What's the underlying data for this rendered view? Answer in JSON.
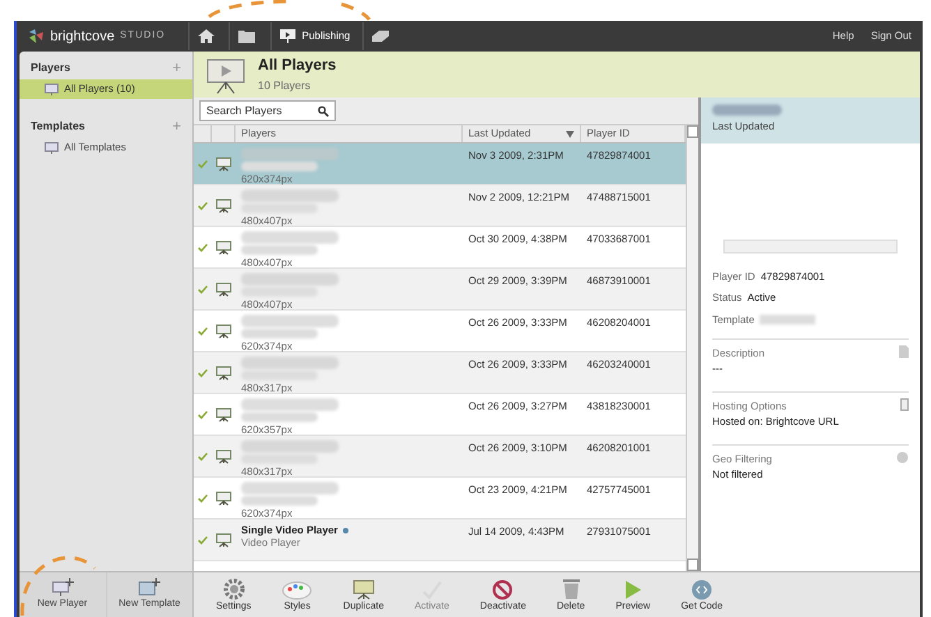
{
  "top_bar": {
    "logo": "brightcove",
    "logo_suffix": "STUDIO",
    "nav": [
      {
        "kind": "home"
      },
      {
        "kind": "folder"
      },
      {
        "kind": "publishing",
        "label": "Publishing"
      },
      {
        "kind": "stack"
      }
    ],
    "links": [
      "Help",
      "Sign Out"
    ]
  },
  "sidebar": {
    "sections": [
      {
        "title": "Players",
        "action": "+",
        "items": [
          {
            "label": "All Players",
            "count": "(10)",
            "selected": true
          }
        ]
      },
      {
        "title": "Templates",
        "action": "+",
        "items": [
          {
            "label": "All Templates",
            "selected": false
          }
        ]
      }
    ]
  },
  "header": {
    "title": "All Players",
    "subtitle": "10 Players"
  },
  "search": {
    "placeholder": "Search Players"
  },
  "table": {
    "columns": [
      "Players",
      "Last Updated",
      "Player ID"
    ],
    "rows": [
      {
        "size": "620x374px",
        "updated": "Nov 3 2009, 2:31PM",
        "id": "47829874001",
        "selected": true,
        "active": true
      },
      {
        "size": "480x407px",
        "updated": "Nov 2 2009, 12:21PM",
        "id": "47488715001",
        "selected": false,
        "active": true
      },
      {
        "size": "480x407px",
        "updated": "Oct 30 2009, 4:38PM",
        "id": "47033687001",
        "selected": false,
        "active": true
      },
      {
        "size": "480x407px",
        "updated": "Oct 29 2009, 3:39PM",
        "id": "46873910001",
        "selected": false,
        "active": true
      },
      {
        "size": "620x374px",
        "updated": "Oct 26 2009, 3:33PM",
        "id": "46208204001",
        "selected": false,
        "active": true
      },
      {
        "size": "480x317px",
        "updated": "Oct 26 2009, 3:33PM",
        "id": "46203240001",
        "selected": false,
        "active": true
      },
      {
        "size": "620x357px",
        "updated": "Oct 26 2009, 3:27PM",
        "id": "43818230001",
        "selected": false,
        "active": true
      },
      {
        "size": "480x317px",
        "updated": "Oct 26 2009, 3:10PM",
        "id": "46208201001",
        "selected": false,
        "active": true
      },
      {
        "size": "620x374px",
        "updated": "Oct 23 2009, 4:21PM",
        "id": "42757745001",
        "selected": false,
        "active": true
      },
      {
        "name": "Single Video Player",
        "subtitle": "Video Player",
        "updated": "Jul 14 2009, 4:43PM",
        "id": "27931075001",
        "selected": false,
        "active": true
      }
    ]
  },
  "details": {
    "subtitle": "Last Updated",
    "fields": [
      {
        "label": "Player ID",
        "value": "47829874001"
      },
      {
        "label": "Status",
        "value": "Active"
      },
      {
        "label": "Template"
      }
    ],
    "sections": [
      {
        "kind": "description",
        "title": "Description",
        "value": "---"
      },
      {
        "kind": "hosting",
        "title": "Hosting Options",
        "value": "Hosted on: Brightcove URL"
      },
      {
        "kind": "geo",
        "title": "Geo Filtering",
        "value": "Not filtered"
      }
    ]
  },
  "left_toolbar": [
    {
      "kind": "new-player",
      "label": "New Player"
    },
    {
      "kind": "new-template",
      "label": "New Template"
    }
  ],
  "toolbar": [
    {
      "kind": "settings",
      "label": "Settings",
      "disabled": false
    },
    {
      "kind": "styles",
      "label": "Styles",
      "disabled": false
    },
    {
      "kind": "duplicate",
      "label": "Duplicate",
      "disabled": false
    },
    {
      "kind": "activate",
      "label": "Activate",
      "disabled": true
    },
    {
      "kind": "deactivate",
      "label": "Deactivate",
      "disabled": false
    },
    {
      "kind": "delete",
      "label": "Delete",
      "disabled": false
    },
    {
      "kind": "preview",
      "label": "Preview",
      "disabled": false
    },
    {
      "kind": "code",
      "label": "Get Code",
      "disabled": false
    }
  ]
}
